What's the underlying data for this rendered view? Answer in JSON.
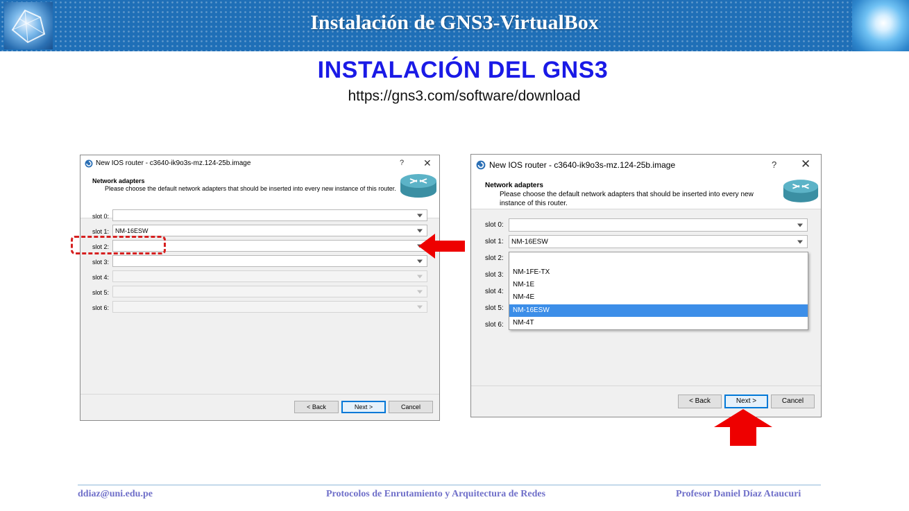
{
  "slide": {
    "banner_title": "Instalación de GNS3-VirtualBox",
    "main_title": "INSTALACIÓN DEL GNS3",
    "url": "https://gns3.com/software/download",
    "footer": {
      "email": "ddiaz@uni.edu.pe",
      "course": "Protocolos de Enrutamiento y Arquitectura de Redes",
      "professor": "Profesor Daniel Díaz Ataucuri"
    }
  },
  "dialog_left": {
    "title": "New IOS router - c3640-ik9o3s-mz.124-25b.image",
    "help": "?",
    "close": "✕",
    "section": "Network adapters",
    "description": "Please choose the default network adapters that should be inserted into every new instance of this router.",
    "slots": [
      {
        "label": "slot 0:",
        "value": ""
      },
      {
        "label": "slot 1:",
        "value": "NM-16ESW"
      },
      {
        "label": "slot 2:",
        "value": ""
      },
      {
        "label": "slot 3:",
        "value": ""
      },
      {
        "label": "slot 4:",
        "value": ""
      },
      {
        "label": "slot 5:",
        "value": ""
      },
      {
        "label": "slot 6:",
        "value": ""
      }
    ],
    "buttons": {
      "back": "< Back",
      "next": "Next >",
      "cancel": "Cancel"
    }
  },
  "dialog_right": {
    "title": "New IOS router - c3640-ik9o3s-mz.124-25b.image",
    "help": "?",
    "close": "✕",
    "section": "Network adapters",
    "description": "Please choose the default network adapters that should be inserted into every new instance of this router.",
    "slots": [
      {
        "label": "slot 0:",
        "value": ""
      },
      {
        "label": "slot 1:",
        "value": "NM-16ESW"
      },
      {
        "label": "slot 2:",
        "value": ""
      },
      {
        "label": "slot 3:",
        "value": ""
      },
      {
        "label": "slot 4:",
        "value": ""
      },
      {
        "label": "slot 5:",
        "value": ""
      },
      {
        "label": "slot 6:",
        "value": ""
      }
    ],
    "dropdown_options": [
      "",
      "NM-1FE-TX",
      "NM-1E",
      "NM-4E",
      "NM-16ESW",
      "NM-4T"
    ],
    "dropdown_selected": "NM-16ESW",
    "buttons": {
      "back": "< Back",
      "next": "Next >",
      "cancel": "Cancel"
    }
  },
  "colors": {
    "banner": "#1f6fb7",
    "title_blue": "#1a1ae6",
    "annotation_red": "#e00000",
    "selection_blue": "#3c8ee8",
    "footer_text": "#6f6fc9"
  }
}
